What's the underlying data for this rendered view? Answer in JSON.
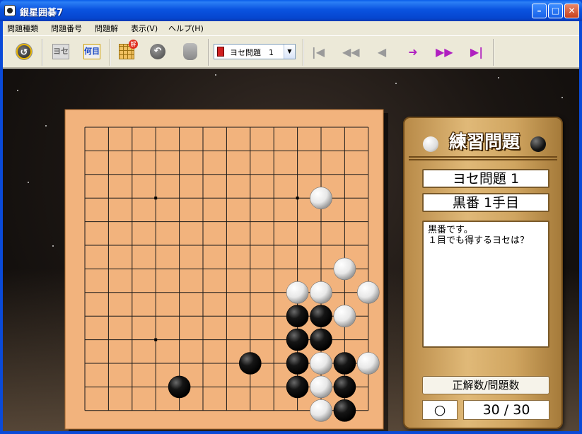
{
  "window": {
    "title": "銀星囲碁7"
  },
  "menu": [
    "問題種類",
    "問題番号",
    "問題解",
    "表示(V)",
    "ヘルプ(H)"
  ],
  "toolbar": {
    "problem_select": "ヨセ問題　1",
    "tile_yose": "ヨセ",
    "tile_nanmoku": "何目",
    "answer_badge": "解"
  },
  "panel": {
    "title": "練習問題",
    "problem_name": "ヨセ問題 1",
    "turn": "黒番 1手目",
    "message": "黒番です。\n１目でも得するヨセは？",
    "stat_label": "正解数/問題数",
    "result_mark": "○",
    "score": "30 / 30"
  },
  "board": {
    "size": 13,
    "black_stones": [
      [
        9,
        8
      ],
      [
        10,
        8
      ],
      [
        9,
        9
      ],
      [
        10,
        9
      ],
      [
        7,
        10
      ],
      [
        9,
        10
      ],
      [
        11,
        10
      ],
      [
        4,
        11
      ],
      [
        9,
        11
      ],
      [
        11,
        11
      ],
      [
        11,
        12
      ]
    ],
    "white_stones": [
      [
        10,
        3
      ],
      [
        11,
        6
      ],
      [
        9,
        7
      ],
      [
        10,
        7
      ],
      [
        12,
        7
      ],
      [
        11,
        8
      ],
      [
        10,
        10
      ],
      [
        12,
        10
      ],
      [
        10,
        11
      ],
      [
        10,
        12
      ]
    ],
    "star_points": [
      [
        3,
        3
      ],
      [
        9,
        3
      ],
      [
        3,
        9
      ]
    ]
  },
  "colors": {
    "board": "#f2b37d",
    "grid": "#1a1a1a",
    "panel": "#d9b06a"
  }
}
